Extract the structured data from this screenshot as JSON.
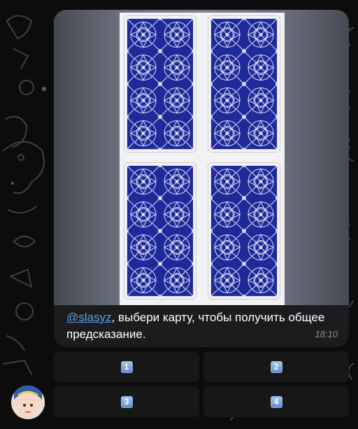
{
  "message": {
    "mention": "@slasyz",
    "text": ", выбери карту, чтобы получить общее предсказание.",
    "time": "18:10"
  },
  "keyboard": {
    "buttons": [
      {
        "label": "1",
        "icon": "keycap-1-emoji"
      },
      {
        "label": "2",
        "icon": "keycap-2-emoji"
      },
      {
        "label": "3",
        "icon": "keycap-3-emoji"
      },
      {
        "label": "4",
        "icon": "keycap-4-emoji"
      }
    ]
  },
  "image": {
    "content": "four tarot card backs with blue geometric pattern"
  },
  "colors": {
    "background": "#0b0c0b",
    "bubble": "#1c1c1e",
    "link": "#5aa0e6",
    "card_blue": "#1f2a9a",
    "keycap": "#6f9bd6"
  }
}
